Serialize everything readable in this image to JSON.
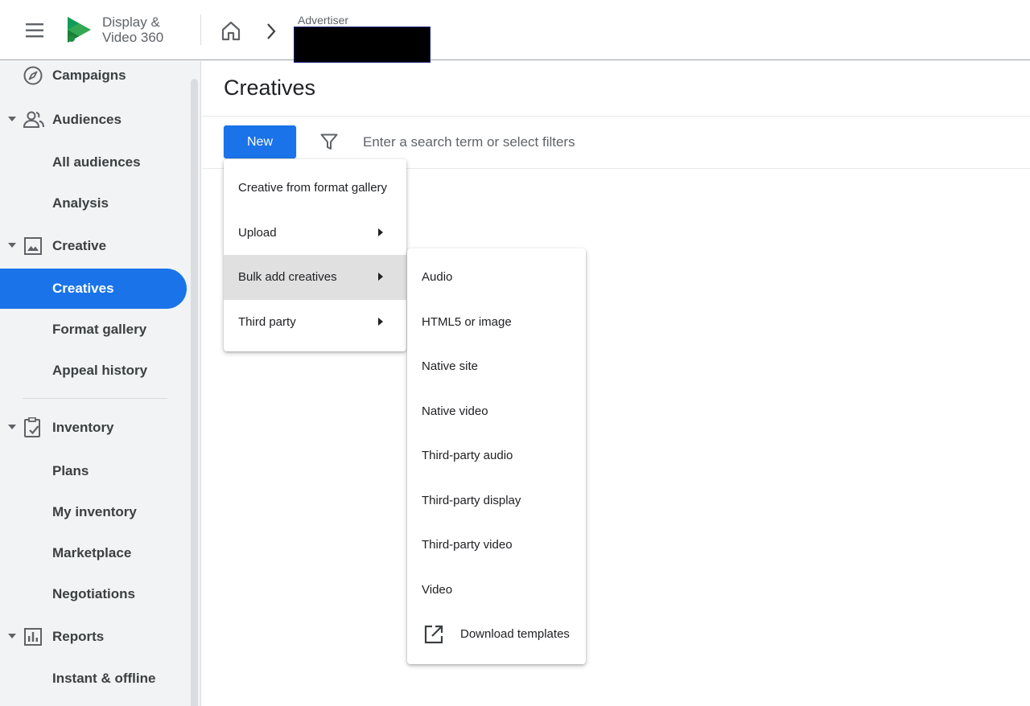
{
  "app": {
    "name_line1": "Display &",
    "name_line2": "Video 360"
  },
  "breadcrumb": {
    "advertiser_label": "Advertiser"
  },
  "sidebar": {
    "campaigns": "Campaigns",
    "audiences": "Audiences",
    "all_audiences": "All audiences",
    "analysis": "Analysis",
    "creative": "Creative",
    "creatives": "Creatives",
    "format_gallery": "Format gallery",
    "appeal_history": "Appeal history",
    "inventory": "Inventory",
    "plans": "Plans",
    "my_inventory": "My inventory",
    "marketplace": "Marketplace",
    "negotiations": "Negotiations",
    "reports": "Reports",
    "instant_offline": "Instant & offline"
  },
  "main": {
    "title": "Creatives",
    "new_button": "New",
    "search_placeholder": "Enter a search term or select filters"
  },
  "new_menu": {
    "items": [
      "Creative from format gallery",
      "Upload",
      "Bulk add creatives",
      "Third party"
    ]
  },
  "bulk_menu": {
    "items": [
      "Audio",
      "HTML5 or image",
      "Native site",
      "Native video",
      "Third-party audio",
      "Third-party display",
      "Third-party video",
      "Video"
    ],
    "download_templates": "Download templates"
  },
  "colors": {
    "accent": "#1a73e8",
    "sidebar_bg": "#f1f3f4",
    "menu_highlight": "#e0e0e0"
  },
  "icons": [
    "menu-icon",
    "dv360-logo",
    "home-icon",
    "chevron-right-icon",
    "compass-icon",
    "people-icon",
    "image-icon",
    "clipboard-check-icon",
    "bar-chart-icon",
    "filter-icon",
    "open-in-new-icon"
  ]
}
